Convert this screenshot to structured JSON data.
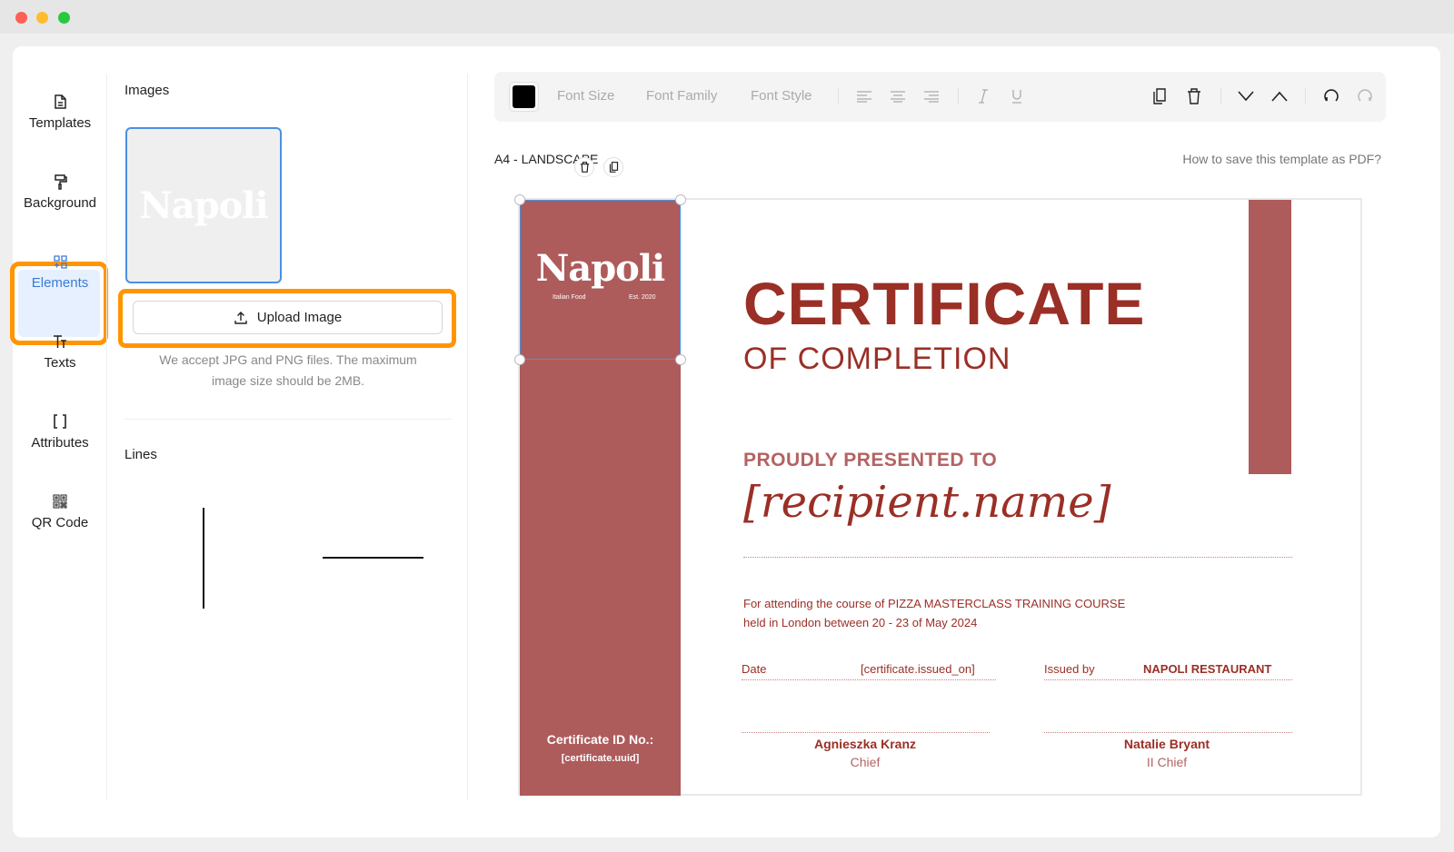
{
  "window": {
    "controls": [
      "close",
      "minimize",
      "maximize"
    ]
  },
  "sidebar": {
    "items": [
      {
        "label": "Templates",
        "icon": "file-icon"
      },
      {
        "label": "Background",
        "icon": "paint-roller-icon"
      },
      {
        "label": "Elements",
        "icon": "elements-grid-icon"
      },
      {
        "label": "Texts",
        "icon": "text-icon"
      },
      {
        "label": "Attributes",
        "icon": "brackets-icon"
      },
      {
        "label": "QR Code",
        "icon": "qr-code-icon"
      }
    ],
    "active": "Elements",
    "active_color": "#3a7bd5",
    "highlight_color": "#ff9500"
  },
  "panel": {
    "images_title": "Images",
    "thumbnail_logo": "Napoli",
    "upload_label": "Upload Image",
    "upload_note": "We accept JPG and PNG files. The maximum image size should be 2MB.",
    "lines_title": "Lines"
  },
  "toolbar": {
    "color": "#000000",
    "font_size": "Font Size",
    "font_family": "Font Family",
    "font_style": "Font Style",
    "icons": [
      "align-left-icon",
      "align-center-icon",
      "align-right-icon",
      "italic-icon",
      "underline-icon",
      "copy-icon",
      "trash-icon",
      "move-down-icon",
      "move-up-icon",
      "undo-icon",
      "redo-icon"
    ]
  },
  "canvas": {
    "page_label": "A4 - LANDSCAPE",
    "help_link": "How to save this template as PDF?"
  },
  "certificate": {
    "brand_color": "#ae5b5b",
    "text_color": "#9a2f26",
    "logo": "Napoli",
    "logo_left": "Italian Food",
    "logo_right": "Est. 2020",
    "title": "CERTIFICATE",
    "subtitle": "OF COMPLETION",
    "presented": "PROUDLY PRESENTED TO",
    "recipient": "[recipient.name]",
    "body_line1": "For attending the course of PIZZA MASTERCLASS TRAINING COURSE",
    "body_line2": "held in London between 20 - 23 of May 2024",
    "date_label": "Date",
    "date_value": "[certificate.issued_on]",
    "issued_label": "Issued by",
    "issued_value": "NAPOLI RESTAURANT",
    "sig1_name": "Agnieszka Kranz",
    "sig1_role": "Chief",
    "sig2_name": "Natalie Bryant",
    "sig2_role": "II Chief",
    "cert_id_label": "Certificate ID No.:",
    "cert_id_value": "[certificate.uuid]"
  }
}
